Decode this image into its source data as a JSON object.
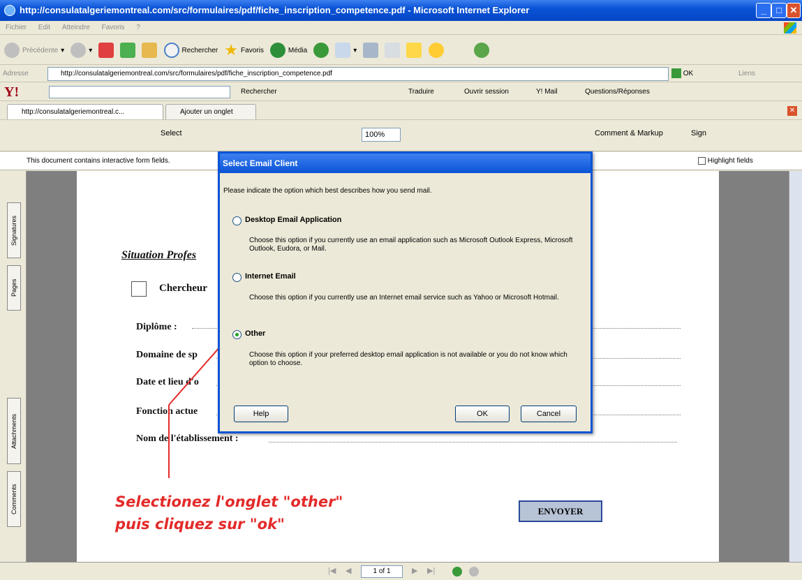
{
  "window": {
    "title": "http://consulatalgeriemontreal.com/src/formulaires/pdf/fiche_inscription_competence.pdf - Microsoft Internet Explorer"
  },
  "menu": [
    "Fichier",
    "Edit",
    "Atteindre",
    "Favoris",
    "?"
  ],
  "toolbar": {
    "back": "Précédente",
    "search": "Rechercher",
    "favorites": "Favoris",
    "media": "Média"
  },
  "address": {
    "label": "Adresse",
    "url": "http://consulatalgeriemontreal.com/src/formulaires/pdf/fiche_inscription_competence.pdf",
    "go": "OK",
    "links": "Liens"
  },
  "yahoo": {
    "search": "Rechercher",
    "translate": "Traduire",
    "login": "Ouvrir session",
    "mail": "Y! Mail",
    "qa": "Questions/Réponses"
  },
  "tabs": {
    "current": "http://consulatalgeriemontreal.c...",
    "add": "Ajouter un onglet"
  },
  "acrobat": {
    "select": "Select",
    "zoom": "100%",
    "comment": "Comment & Markup",
    "sign": "Sign"
  },
  "infobar": {
    "message": "This document contains interactive form fields.",
    "highlight": "Highlight fields"
  },
  "sidetabs": {
    "signatures": "Signatures",
    "pages": "Pages",
    "attachments": "Attachments",
    "comments": "Comments"
  },
  "pdf": {
    "section": "Situation Profes",
    "checkbox_label": "Chercheur",
    "fields": [
      "Diplôme :",
      "Domaine de sp",
      "Date et lieu d'o",
      "Fonction actue",
      "Nom de l'établissement :"
    ],
    "submit": "ENVOYER"
  },
  "dialog": {
    "title": "Select Email Client",
    "prompt": "Please indicate the option which best describes how you send mail.",
    "options": [
      {
        "label": "Desktop Email Application",
        "desc": "Choose this option if you currently use an email application such as Microsoft Outlook Express, Microsoft Outlook, Eudora, or Mail.",
        "selected": false
      },
      {
        "label": "Internet Email",
        "desc": "Choose this option if you currently use an Internet email service such as Yahoo or Microsoft Hotmail.",
        "selected": false
      },
      {
        "label": "Other",
        "desc": "Choose this option if your preferred desktop email application is not available or you do not know which option to choose.",
        "selected": true
      }
    ],
    "help": "Help",
    "ok": "OK",
    "cancel": "Cancel"
  },
  "annotation": {
    "line1": "Selectionez l'onglet \"other\"",
    "line2": "puis cliquez sur \"ok\""
  },
  "pager": {
    "page": "1 of 1"
  },
  "colors": {
    "titlebar": "#0a53d6",
    "annotation": "#e32a2a",
    "chrome": "#ece9d8"
  }
}
